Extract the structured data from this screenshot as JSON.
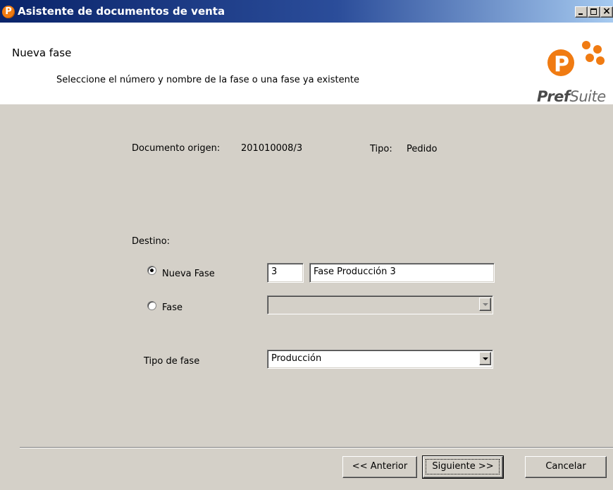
{
  "window": {
    "title": "Asistente de documentos de venta",
    "app_icon_glyph": "P",
    "controls": {
      "minimize": "_",
      "maximize": "□",
      "close": "×"
    }
  },
  "header": {
    "title": "Nueva fase",
    "subtitle": "Seleccione el número y nombre de la fase o una fase ya existente",
    "logo_text_bold": "Pref",
    "logo_text_regular": "Suite"
  },
  "info": {
    "origin_label": "Documento origen:",
    "origin_value": "201010008/3",
    "type_label": "Tipo:",
    "type_value": "Pedido"
  },
  "destination": {
    "label": "Destino:",
    "new_phase_label": "Nueva Fase",
    "new_phase_selected": true,
    "new_phase_number": "3",
    "new_phase_name": "Fase Producción 3",
    "existing_phase_label": "Fase",
    "existing_phase_selected": false,
    "existing_phase_value": ""
  },
  "phase_type": {
    "label": "Tipo de fase",
    "value": "Producción"
  },
  "buttons": {
    "back": "<< Anterior",
    "next": "Siguiente >>",
    "cancel": "Cancelar"
  },
  "colors": {
    "accent_orange": "#f07b12",
    "titlebar_dark": "#0a246a",
    "dialog_gray": "#d4d0c8"
  }
}
